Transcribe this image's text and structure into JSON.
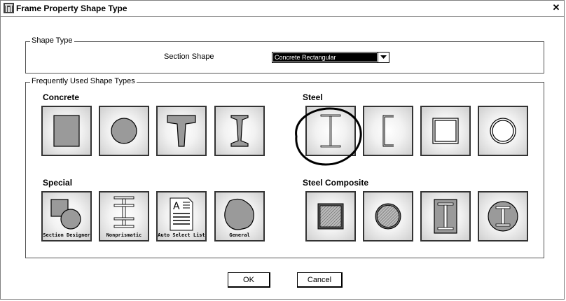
{
  "window": {
    "title": "Frame Property Shape Type",
    "close_label": "✕"
  },
  "shape_type": {
    "group_label": "Shape Type",
    "section_label": "Section Shape",
    "section_value": "Concrete Rectangular"
  },
  "frequent": {
    "group_label": "Frequently Used Shape Types",
    "concrete": {
      "heading": "Concrete",
      "tiles": [
        "rectangular-section-icon",
        "circular-section-icon",
        "tee-section-icon",
        "i-section-icon"
      ]
    },
    "steel": {
      "heading": "Steel",
      "tiles": [
        "i-wide-flange-icon",
        "channel-section-icon",
        "box-tube-icon",
        "pipe-section-icon"
      ]
    },
    "special": {
      "heading": "Special",
      "tiles": [
        {
          "icon": "section-designer-icon",
          "label": "Section Designer"
        },
        {
          "icon": "nonprismatic-icon",
          "label": "Nonprismatic"
        },
        {
          "icon": "auto-select-list-icon",
          "label": "Auto Select List"
        },
        {
          "icon": "general-section-icon",
          "label": "General"
        }
      ]
    },
    "steel_composite": {
      "heading": "Steel Composite",
      "tiles": [
        "filled-box-icon",
        "filled-pipe-icon",
        "encased-rect-i-icon",
        "encased-round-i-icon"
      ]
    }
  },
  "buttons": {
    "ok": "OK",
    "cancel": "Cancel"
  },
  "colors": {
    "shape_fill": "#9a9a9a",
    "highlight": "#000000"
  }
}
